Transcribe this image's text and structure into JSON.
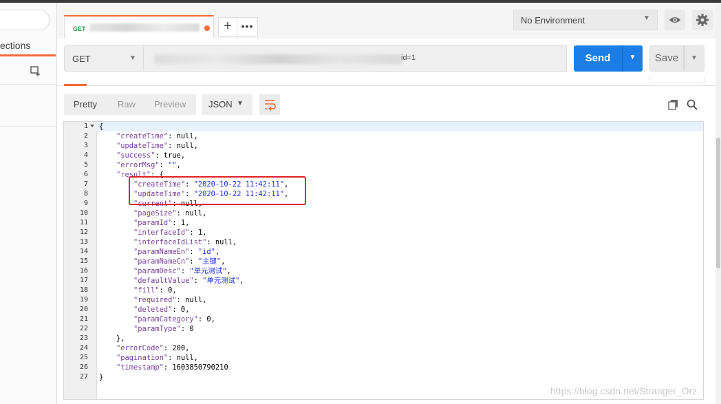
{
  "sidebar": {
    "tab_label": "ections",
    "new_collection_icon": "folder-add-icon"
  },
  "request_tab": {
    "method": "GET"
  },
  "tabs": {
    "new_tab": "+",
    "more": "•••"
  },
  "environment": {
    "selected": "No Environment",
    "eye_icon": "eye-icon",
    "gear_icon": "gear-icon"
  },
  "url_bar": {
    "method": "GET",
    "url_visible_part": "id=1"
  },
  "actions": {
    "send_label": "Send",
    "save_label": "Save"
  },
  "response_toolbar": {
    "view_tabs": [
      "Pretty",
      "Raw",
      "Preview"
    ],
    "active_view": "Pretty",
    "format": "JSON",
    "icons": [
      "wrap-lines-icon",
      "copy-icon",
      "search-icon"
    ]
  },
  "code": {
    "line_numbers": [
      "1",
      "2",
      "3",
      "4",
      "5",
      "6",
      "7",
      "8",
      "9",
      "10",
      "11",
      "12",
      "13",
      "14",
      "15",
      "16",
      "17",
      "18",
      "19",
      "20",
      "21",
      "22",
      "23",
      "24",
      "25",
      "26",
      "27"
    ],
    "lines": [
      "{",
      "    \"createTime\": null,",
      "    \"updateTime\": null,",
      "    \"success\": true,",
      "    \"errorMsg\": \"\",",
      "    \"result\": {",
      "        \"createTime\": \"2020-10-22 11:42:11\",",
      "        \"updateTime\": \"2020-10-22 11:42:11\",",
      "        \"current\": null,",
      "        \"pageSize\": null,",
      "        \"paramId\": 1,",
      "        \"interfaceId\": 1,",
      "        \"interfaceIdList\": null,",
      "        \"paramNameEn\": \"id\",",
      "        \"paramNameCn\": \"主键\",",
      "        \"paramDesc\": \"单元测试\",",
      "        \"defaultValue\": \"单元测试\",",
      "        \"fill\": 0,",
      "        \"required\": null,",
      "        \"deleted\": 0,",
      "        \"paramCategory\": 0,",
      "        \"paramType\": 0",
      "    },",
      "    \"errorCode\": 200,",
      "    \"pagination\": null,",
      "    \"timestamp\": 1603850790210",
      "}"
    ]
  },
  "watermark": "https://blog.csdn.net/Stranger_Orz",
  "colors": {
    "accent": "#f26b3a",
    "send": "#1a7ee6",
    "highlight": "#e02020",
    "json_key": "#7a3e9d",
    "json_string": "#1c2ce0"
  }
}
